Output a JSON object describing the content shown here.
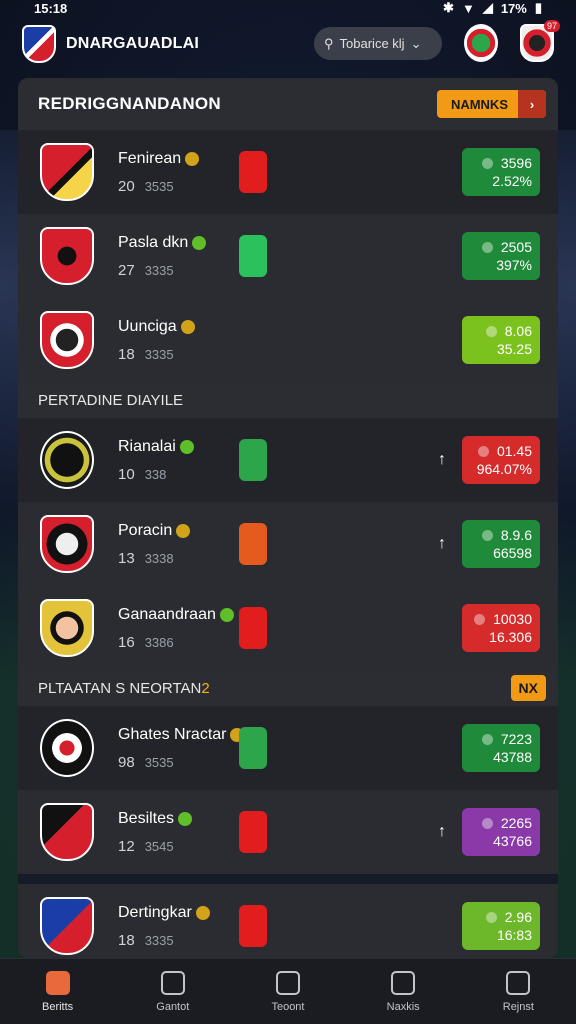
{
  "status": {
    "time": "15:18",
    "battery": "17%"
  },
  "header": {
    "app_name": "DNARGAUADLAI",
    "search_label": "Tobarice klj"
  },
  "panel": {
    "title": "REDRIGGNANDANON",
    "button_label": "NAMNKS",
    "section2_label": "PERTADINE DIAYILE",
    "section3_label": "PLTAATAN S NEORTAN",
    "section3_accent": "2",
    "section3_button": "NX"
  },
  "teams": [
    {
      "name": "Fenirean",
      "stat": "20",
      "sub": "3535",
      "odds_top": "3596",
      "odds_bottom": "2.52%",
      "chip": "#e21d1d",
      "odds_color": "#1f8a3a",
      "crest": "linear-gradient(135deg,#d61f2c 0 50%,#111 50% 60%,#f5d44a 60%)"
    },
    {
      "name": "Pasla dkn",
      "stat": "27",
      "sub": "3335",
      "odds_top": "2505",
      "odds_bottom": "397%",
      "chip": "#2bc25d",
      "odds_color": "#1f8a3a",
      "crest": "radial-gradient(circle,#111 0 25%,#d61f2c 26%)"
    },
    {
      "name": "Uunciga",
      "stat": "18",
      "sub": "3335",
      "odds_top": "8.06",
      "odds_bottom": "35.25",
      "chip": "",
      "odds_color": "#7cc21f",
      "crest": "radial-gradient(circle,#222 0 30%,#fff 31% 45%,#d61f2c 46%)"
    },
    {
      "name": "Rianalai",
      "stat": "10",
      "sub": "338",
      "odds_top": "01.45",
      "odds_bottom": "964.07%",
      "chip": "#2da54a",
      "odds_color": "#d62b2b",
      "crest": "radial-gradient(circle,#111 0 45%,#c9c23a 46% 60%,#1a1a1a 61%)"
    },
    {
      "name": "Poracin",
      "stat": "13",
      "sub": "3338",
      "odds_top": "8.9.6",
      "odds_bottom": "66598",
      "chip": "#e55a1d",
      "odds_color": "#1f8a3a",
      "crest": "radial-gradient(circle,#eee 0 30%,#111 31% 55%,#d61f2c 56%)"
    },
    {
      "name": "Ganaandraan",
      "stat": "16",
      "sub": "3386",
      "odds_top": "10030",
      "odds_bottom": "16.306",
      "chip": "#e21d1d",
      "odds_color": "#d62b2b",
      "crest": "radial-gradient(circle,#f3c3a1 0 30%,#111 31% 45%,#e2c33a 46%)"
    },
    {
      "name": "Ghates Nractar",
      "stat": "98",
      "sub": "3535",
      "odds_top": "7223",
      "odds_bottom": "43788",
      "chip": "#2da54a",
      "odds_color": "#1f8a3a",
      "crest": "radial-gradient(circle,#d61f2c 0 20%,#fff 21% 40%,#111 41%)"
    },
    {
      "name": "Besiltes",
      "stat": "12",
      "sub": "3545",
      "odds_top": "2265",
      "odds_bottom": "43766",
      "chip": "#e21d1d",
      "odds_color": "#8a3aa8",
      "crest": "linear-gradient(135deg,#111 0 40%,#d61f2c 40%)"
    },
    {
      "name": "Dertingkar",
      "stat": "18",
      "sub": "3335",
      "odds_top": "2.96",
      "odds_bottom": "16:83",
      "chip": "#e21d1d",
      "odds_color": "#6cb82a",
      "crest": "linear-gradient(135deg,#1b3da8 0 50%,#d61f2c 50%)"
    }
  ],
  "nav": [
    {
      "label": "Beritts",
      "active": true
    },
    {
      "label": "Gantot",
      "active": false
    },
    {
      "label": "Teoont",
      "active": false
    },
    {
      "label": "Naxkis",
      "active": false
    },
    {
      "label": "Rejnst",
      "active": false
    }
  ]
}
